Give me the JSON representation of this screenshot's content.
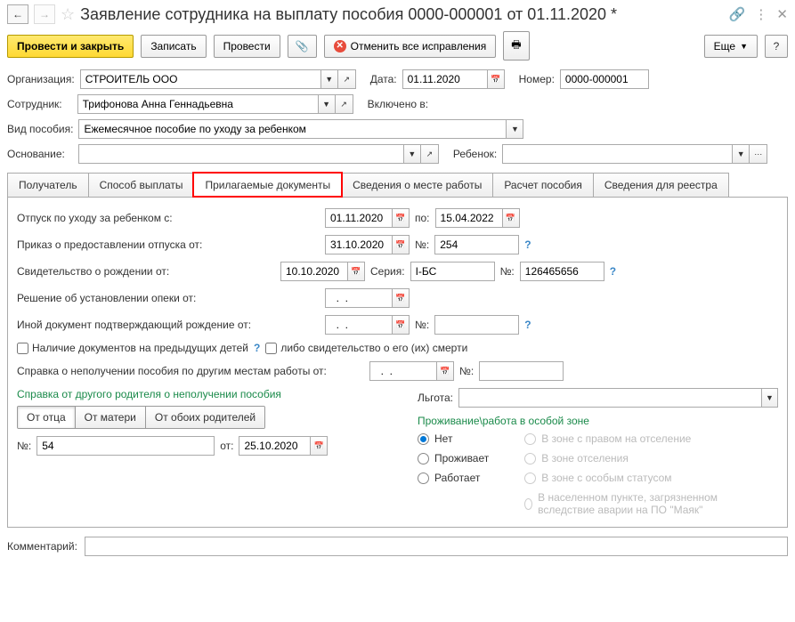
{
  "title": "Заявление сотрудника на выплату пособия 0000-000001 от 01.11.2020 *",
  "toolbar": {
    "save_close": "Провести и закрыть",
    "save": "Записать",
    "post": "Провести",
    "cancel_fixes": "Отменить все исправления",
    "more": "Еще"
  },
  "header": {
    "org_label": "Организация:",
    "org": "СТРОИТЕЛЬ ООО",
    "date_label": "Дата:",
    "date": "01.11.2020",
    "number_label": "Номер:",
    "number": "0000-000001",
    "employee_label": "Сотрудник:",
    "employee": "Трифонова Анна Геннадьевна",
    "included_label": "Включено в:",
    "benefit_type_label": "Вид пособия:",
    "benefit_type": "Ежемесячное пособие по уходу за ребенком",
    "basis_label": "Основание:",
    "child_label": "Ребенок:"
  },
  "tabs": [
    "Получатель",
    "Способ выплаты",
    "Прилагаемые документы",
    "Сведения о месте работы",
    "Расчет пособия",
    "Сведения для реестра"
  ],
  "docs": {
    "leave_from_label": "Отпуск по уходу за ребенком с:",
    "leave_from": "01.11.2020",
    "leave_to_label": "по:",
    "leave_to": "15.04.2022",
    "order_label": "Приказ о предоставлении отпуска от:",
    "order_date": "31.10.2020",
    "order_no_label": "№:",
    "order_no": "254",
    "birth_cert_label": "Свидетельство о рождении от:",
    "birth_cert_date": "10.10.2020",
    "birth_cert_series_label": "Серия:",
    "birth_cert_series": "I-БС",
    "birth_cert_no_label": "№:",
    "birth_cert_no": "126465656",
    "guardianship_label": "Решение об установлении опеки от:",
    "date_placeholder": "  .  .    ",
    "other_doc_label": "Иной документ подтверждающий рождение от:",
    "other_doc_no_label": "№:",
    "prev_children": "Наличие документов на предыдущих детей",
    "death_cert": "либо свидетельство о его (их) смерти",
    "other_work_cert_label": "Справка о неполучении пособия по другим местам работы от:",
    "other_work_cert_no_label": "№:",
    "other_parent_cert": "Справка от другого родителя о неполучении пособия",
    "toggles": {
      "father": "От отца",
      "mother": "От матери",
      "both": "От обоих родителей"
    },
    "ref_no_label": "№:",
    "ref_no": "54",
    "ref_date_label": "от:",
    "ref_date": "25.10.2020",
    "privilege_label": "Льгота:",
    "zone_title": "Проживание\\работа в особой зоне",
    "radios": {
      "no": "Нет",
      "lives": "Проживает",
      "works": "Работает",
      "resettle": "В зоне с правом на отселение",
      "resettle2": "В зоне отселения",
      "special": "В зоне с особым статусом",
      "mayak": "В населенном пункте, загрязненном вследствие аварии на ПО \"Маяк\""
    }
  },
  "comment_label": "Комментарий:"
}
